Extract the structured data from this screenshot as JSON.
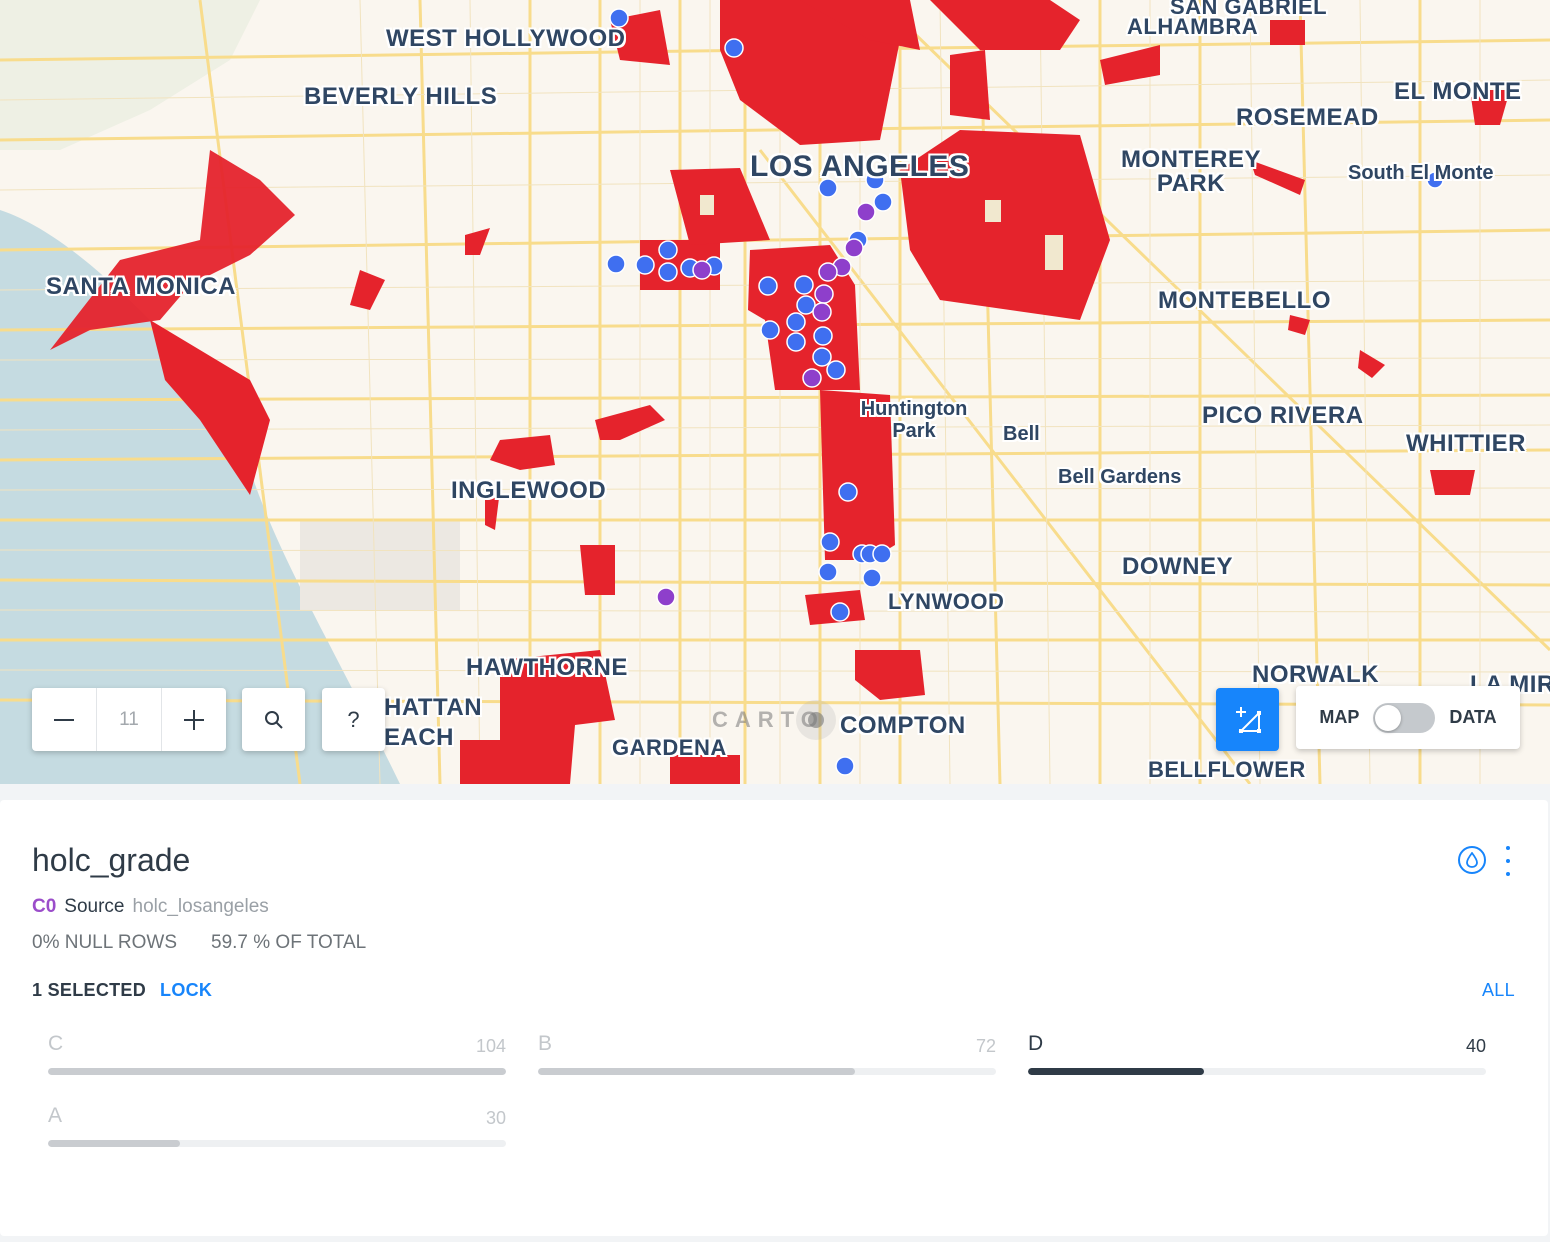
{
  "map": {
    "city_labels": [
      {
        "id": "west-hollywood",
        "text": "WEST HOLLYWOOD"
      },
      {
        "id": "beverly-hills",
        "text": "BEVERLY HILLS"
      },
      {
        "id": "san-gabriel",
        "text": "SAN GABRIEL"
      },
      {
        "id": "alhambra",
        "text": "ALHAMBRA"
      },
      {
        "id": "el-monte",
        "text": "EL MONTE"
      },
      {
        "id": "rosemead",
        "text": "ROSEMEAD"
      },
      {
        "id": "los-angeles",
        "text": "LOS ANGELES"
      },
      {
        "id": "monterey-park",
        "text": "MONTEREY PARK"
      },
      {
        "id": "south-el-monte",
        "text": "South El Monte"
      },
      {
        "id": "santa-monica",
        "text": "SANTA MONICA"
      },
      {
        "id": "montebello",
        "text": "MONTEBELLO"
      },
      {
        "id": "huntington-park",
        "text": "Huntington Park"
      },
      {
        "id": "bell",
        "text": "Bell"
      },
      {
        "id": "pico-rivera",
        "text": "PICO RIVERA"
      },
      {
        "id": "whittier",
        "text": "WHITTIER"
      },
      {
        "id": "bell-gardens",
        "text": "Bell Gardens"
      },
      {
        "id": "inglewood",
        "text": "INGLEWOOD"
      },
      {
        "id": "downey",
        "text": "DOWNEY"
      },
      {
        "id": "lynwood",
        "text": "LYNWOOD"
      },
      {
        "id": "hawthorne",
        "text": "HAWTHORNE"
      },
      {
        "id": "norwalk",
        "text": "NORWALK"
      },
      {
        "id": "la-mirada",
        "text": "LA MIR"
      },
      {
        "id": "manhattan-beach",
        "text": "HATTAN EACH"
      },
      {
        "id": "compton",
        "text": "COMPTON"
      },
      {
        "id": "gardena",
        "text": "GARDENA"
      },
      {
        "id": "bellflower",
        "text": "BELLFLOWER"
      }
    ],
    "zoom_level": "11",
    "zoom_out_icon": "minus-icon",
    "zoom_in_icon": "plus-icon",
    "search_icon": "search-icon",
    "help_label": "?",
    "draw_icon": "draw-polygon-icon",
    "toggle": {
      "left": "MAP",
      "right": "DATA",
      "state": "MAP"
    },
    "attribution": "CARTO",
    "colors": {
      "polygon": "#e5232c",
      "point_blue": "#3f6ff0",
      "point_purple": "#8e3fcb",
      "water": "#c5dbe1",
      "land": "#faf6ef",
      "road": "#f8dc8c"
    }
  },
  "widget": {
    "title": "holc_grade",
    "source_id": "C0",
    "source_label": "Source",
    "source_name": "holc_losangeles",
    "null_rows": "0% NULL ROWS",
    "of_total": "59.7 % OF TOTAL",
    "selected": "1 SELECTED",
    "lock": "LOCK",
    "all": "ALL",
    "color_icon": "drop-icon",
    "more_icon": "more-vertical-icon",
    "categories": [
      {
        "label": "C",
        "count": "104",
        "value": 104,
        "fraction": 1.0,
        "selected": false
      },
      {
        "label": "B",
        "count": "72",
        "value": 72,
        "fraction": 0.692,
        "selected": false
      },
      {
        "label": "D",
        "count": "40",
        "value": 40,
        "fraction": 0.385,
        "selected": true
      },
      {
        "label": "A",
        "count": "30",
        "value": 30,
        "fraction": 0.288,
        "selected": false
      }
    ]
  }
}
